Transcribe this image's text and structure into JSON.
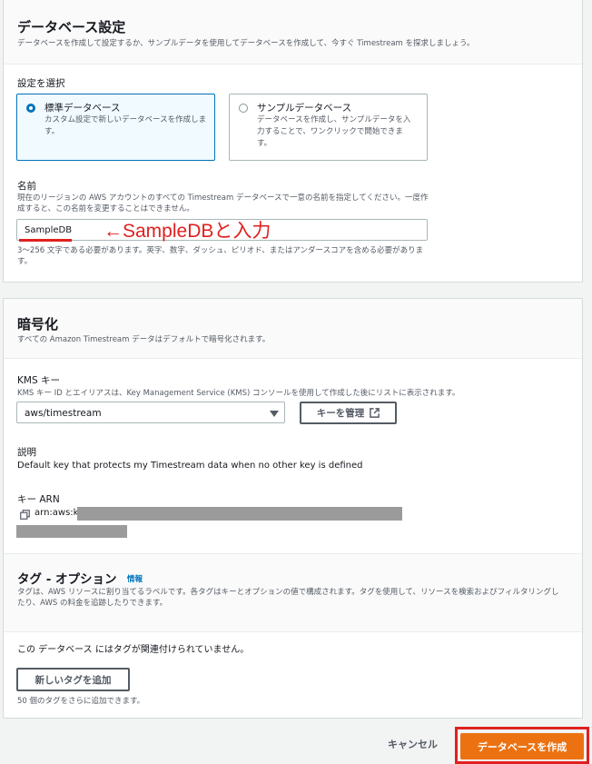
{
  "db_settings": {
    "title": "データベース設定",
    "description": "データベースを作成して設定するか、サンプルデータを使用してデータベースを作成して、今すぐ Timestream を探求しましょう。",
    "choose_label": "設定を選択",
    "options": [
      {
        "title": "標準データベース",
        "desc": "カスタム設定で新しいデータベースを作成します。",
        "selected": true
      },
      {
        "title": "サンプルデータベース",
        "desc": "データベースを作成し、サンプルデータを入力することで、ワンクリックで開始できます。",
        "selected": false
      }
    ],
    "name_label": "名前",
    "name_desc": "現在のリージョンの AWS アカウントのすべての Timestream データベースで一意の名前を指定してください。一度作成すると、この名前を変更することはできません。",
    "name_value": "SampleDB",
    "name_constraint": "3〜256 文字である必要があります。英字、数字、ダッシュ、ピリオド、またはアンダースコアを含める必要があります。",
    "annotation": "←SampleDBと入力"
  },
  "encryption": {
    "title": "暗号化",
    "description": "すべての Amazon Timestream データはデフォルトで暗号化されます。",
    "kms_label": "KMS キー",
    "kms_desc": "KMS キー ID とエイリアスは、Key Management Service (KMS) コンソールを使用して作成した後にリストに表示されます。",
    "kms_selected": "aws/timestream",
    "manage_key_button": "キーを管理",
    "description_label": "説明",
    "description_value": "Default key that protects my Timestream data when no other key is defined",
    "arn_label": "キー ARN",
    "arn_prefix": "arn:aws:kı"
  },
  "tags": {
    "title": "タグ - オプション",
    "info_link": "情報",
    "description": "タグは、AWS リソースに割り当てるラベルです。各タグはキーとオプションの値で構成されます。タグを使用して、リソースを検索およびフィルタリングしたり、AWS の料金を追跡したりできます。",
    "empty_text": "この データベース にはタグが関連付けられていません。",
    "add_button": "新しいタグを追加",
    "remaining": "50 個のタグをさらに追加できます。"
  },
  "footer": {
    "cancel_button": "キャンセル",
    "create_button": "データベースを作成"
  },
  "colors": {
    "primary": "#ec7211",
    "link": "#0073bb",
    "annotation": "#e02020"
  }
}
